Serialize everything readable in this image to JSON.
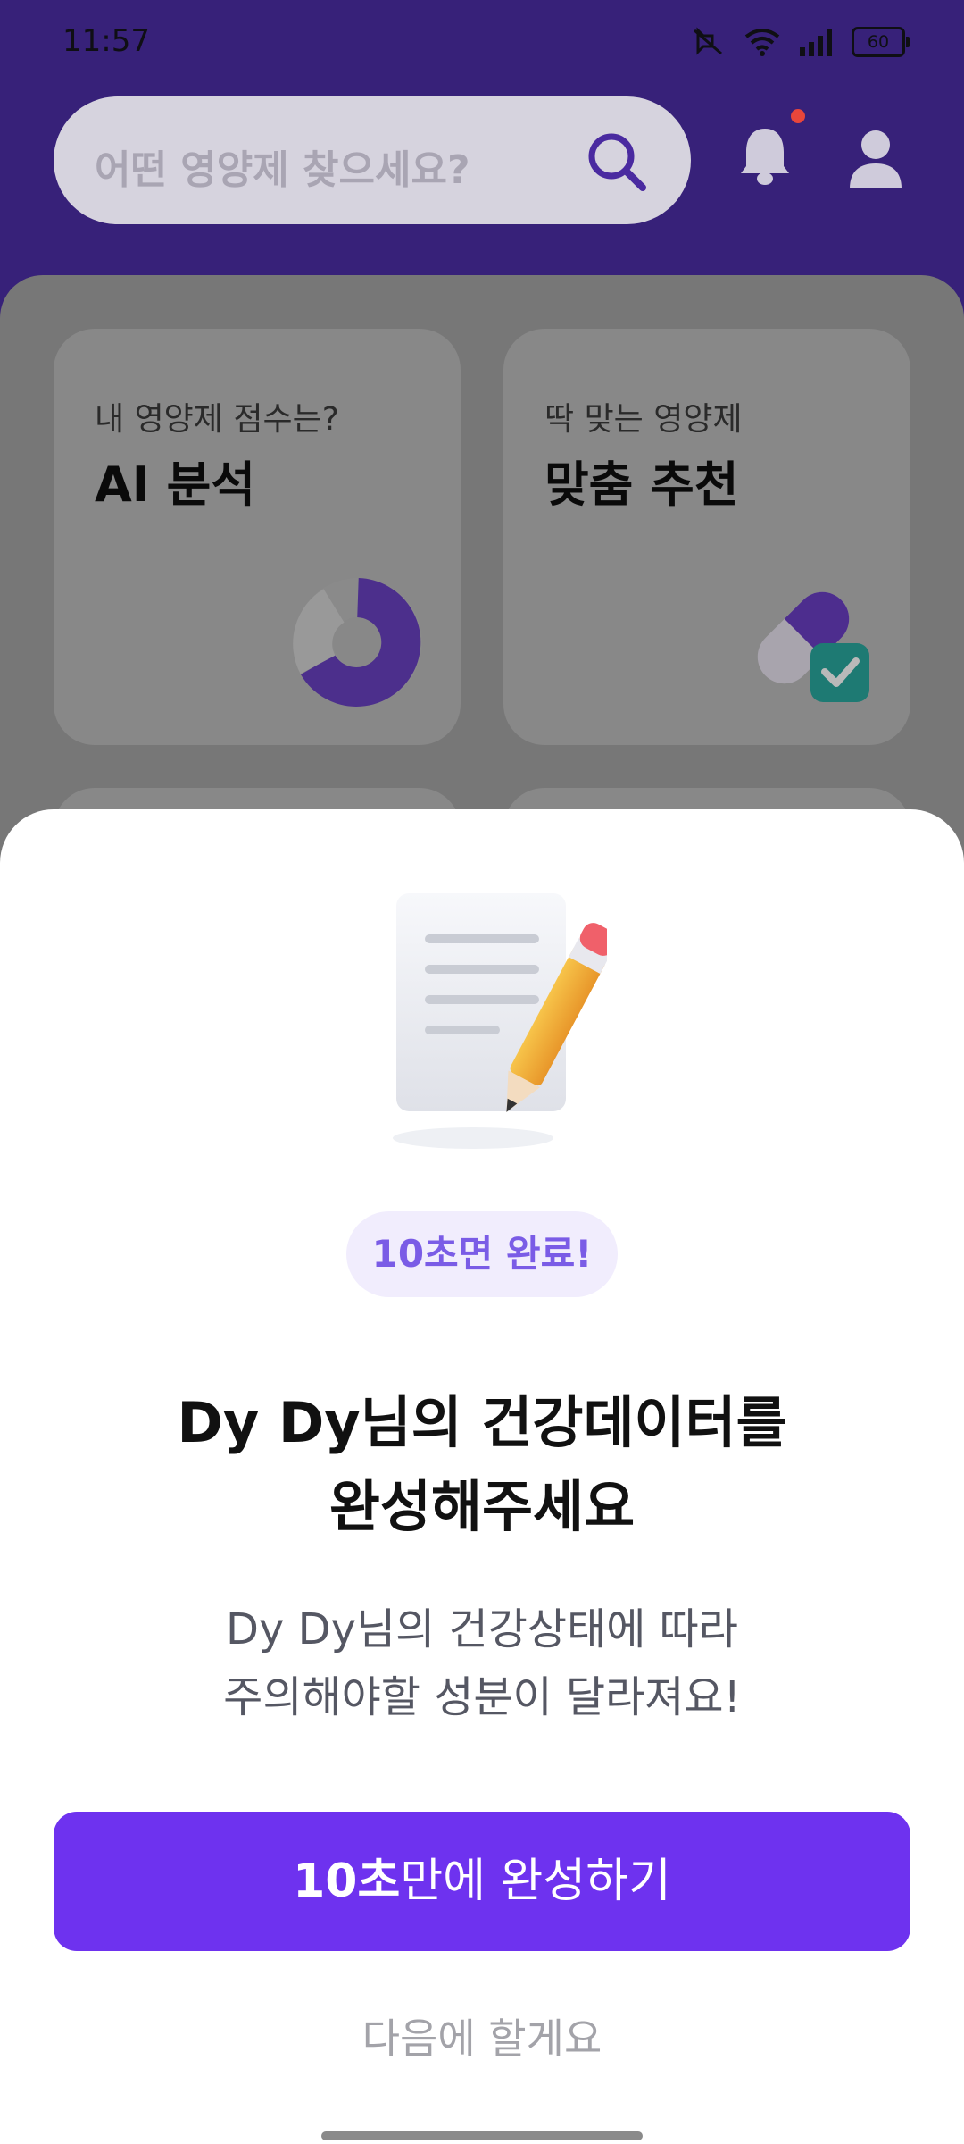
{
  "status_bar": {
    "time": "11:57",
    "battery": "60",
    "icons": [
      "mute-icon",
      "wifi-icon",
      "signal-icon",
      "battery-icon"
    ]
  },
  "header": {
    "search_placeholder": "어떤 영양제 찾으세요?",
    "icons": [
      "search-icon",
      "bell-icon",
      "profile-icon"
    ],
    "notification_dot_color": "#e8463b"
  },
  "cards": [
    {
      "subtitle": "내 영양제 점수는?",
      "title": "AI 분석",
      "icon": "donut-chart-icon"
    },
    {
      "subtitle": "딱 맞는 영양제",
      "title": "맞춤 추천",
      "icon": "capsule-check-icon"
    }
  ],
  "sheet": {
    "badge": "10초면 완료!",
    "title_line1": "Dy Dy님의 건강데이터를",
    "title_line2": "완성해주세요",
    "desc_line1": "Dy Dy님의 건강상태에 따라",
    "desc_line2": "주의해야할 성분이 달라져요!",
    "cta_bold": "10초",
    "cta_rest": "만에 완성하기",
    "later": "다음에 할게요",
    "illustration": "document-pencil-icon"
  },
  "colors": {
    "header_bg": "#372179",
    "accent": "#6e32ef",
    "badge_text": "#7a5ce6",
    "badge_bg": "#f1edfd"
  }
}
